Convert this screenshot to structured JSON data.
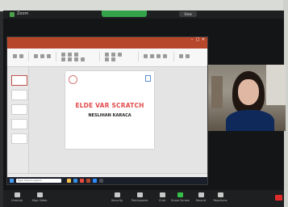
{
  "zoom": {
    "topbar_title": "Zoom",
    "share_banner": "",
    "view_button": "View"
  },
  "ppt": {
    "window_title": "",
    "slide": {
      "header": "",
      "date": "",
      "title": "ELDE VAR SCRATCH",
      "name": "NESLIHAN KARACA",
      "role": ""
    }
  },
  "windows": {
    "search_placeholder": "Type here to search"
  },
  "video": {
    "participant_name": ""
  },
  "toolbar": {
    "items": [
      {
        "label": "Unmute"
      },
      {
        "label": "Stop Video"
      },
      {
        "label": "Security"
      },
      {
        "label": "Participants"
      },
      {
        "label": "Chat"
      },
      {
        "label": "Share Screen"
      },
      {
        "label": "Record"
      },
      {
        "label": "Reactions"
      }
    ]
  },
  "colors": {
    "ppt_accent": "#b7472a",
    "slide_title": "#e34b4b",
    "share_green": "#35a34a",
    "end_red": "#e02b2b"
  }
}
